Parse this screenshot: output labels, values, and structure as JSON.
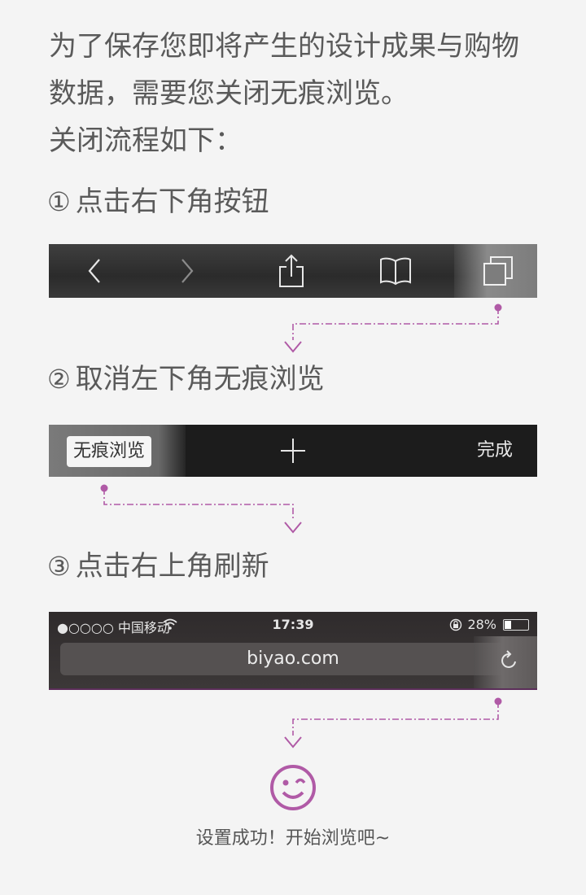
{
  "intro": {
    "line1": "为了保存您即将产生的设计成果与购物",
    "line2": "数据，需要您关闭无痕浏览。",
    "line3": "关闭流程如下："
  },
  "steps": [
    {
      "num": "①",
      "title": "点击右下角按钮"
    },
    {
      "num": "②",
      "title": "取消左下角无痕浏览"
    },
    {
      "num": "③",
      "title": "点击右上角刷新"
    }
  ],
  "toolbar": {
    "icons": [
      "back-icon",
      "forward-icon",
      "share-icon",
      "bookmarks-icon",
      "tabs-icon"
    ]
  },
  "tabbar": {
    "private_label": "无痕浏览",
    "done_label": "完成",
    "add_icon": "plus-icon"
  },
  "addressbar": {
    "carrier": "●○○○○ 中国移动",
    "time": "17:39",
    "battery": "28%",
    "battery_level": 0.28,
    "url": "biyao.com",
    "refresh_icon": "refresh-icon"
  },
  "success": {
    "text": "设置成功！开始浏览吧~",
    "icon": "wink-smiley-icon"
  },
  "colors": {
    "accent": "#b05aa6",
    "background": "#f4f4f4",
    "text": "#5a5a5a"
  }
}
